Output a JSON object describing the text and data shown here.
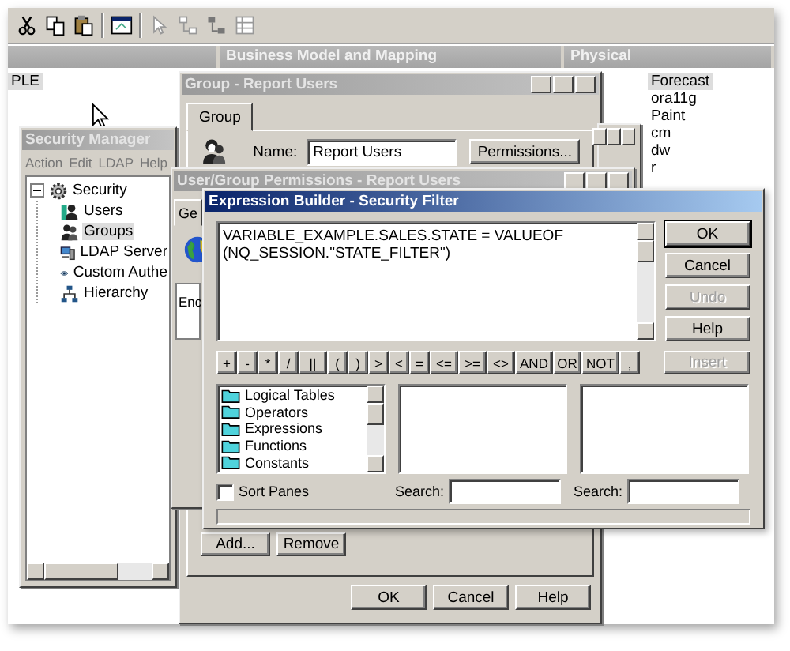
{
  "main_window": {
    "left_panel_items": [
      "PLE"
    ],
    "panel_headers": [
      "Business Model and Mapping",
      "Physical"
    ],
    "physical_items": [
      {
        "label": "Forecast",
        "selected": true
      },
      {
        "label": "ora11g",
        "selected": false
      },
      {
        "label": "Paint",
        "selected": false
      },
      {
        "label": "cm",
        "selected": false
      },
      {
        "label": "dw",
        "selected": false
      },
      {
        "label": "r",
        "selected": false
      }
    ]
  },
  "security_manager": {
    "title": "Security Manager",
    "active": false,
    "menu": [
      "Action",
      "Edit",
      "LDAP",
      "Help"
    ],
    "tree": [
      {
        "label": "Security",
        "kind": "root",
        "expanded": true,
        "selected": false,
        "children": [
          {
            "label": "Users",
            "kind": "user",
            "selected": false
          },
          {
            "label": "Groups",
            "kind": "group",
            "selected": true
          },
          {
            "label": "LDAP Server",
            "kind": "server",
            "selected": false
          },
          {
            "label": "Custom Authe",
            "kind": "eye",
            "selected": false
          },
          {
            "label": "Hierarchy",
            "kind": "hierarchy",
            "selected": false
          }
        ]
      }
    ]
  },
  "group_window": {
    "title": "Group - Report Users",
    "active": false,
    "tabs": [
      {
        "label": "Group",
        "selected": true
      }
    ],
    "name_label": "Name:",
    "name_value": "Report Users",
    "permissions_button": "Permissions...",
    "list_buttons": [
      "Add...",
      "Remove"
    ],
    "dialog_buttons": [
      "OK",
      "Cancel",
      "Help"
    ]
  },
  "permissions_window": {
    "title": "User/Group Permissions - Report Users",
    "active": false,
    "tabs": [
      {
        "label": "Ge",
        "selected": true
      }
    ],
    "list_items": [
      "Enc"
    ]
  },
  "expression_builder": {
    "title": "Expression Builder - Security Filter",
    "active": true,
    "expression": "VARIABLE_EXAMPLE.SALES.STATE = VALUEOF\n(NQ_SESSION.\"STATE_FILTER\")",
    "side_buttons": [
      {
        "label": "OK",
        "disabled": false
      },
      {
        "label": "Cancel",
        "disabled": false
      },
      {
        "label": "Undo",
        "disabled": true
      },
      {
        "label": "Help",
        "disabled": false
      }
    ],
    "operators": [
      "+",
      "-",
      "*",
      "/",
      "||",
      "(",
      ")",
      ">",
      "<",
      "=",
      "<=",
      ">=",
      "<>",
      "AND",
      "OR",
      "NOT",
      ","
    ],
    "insert_button": {
      "label": "Insert",
      "disabled": true
    },
    "categories": [
      "Logical Tables",
      "Operators",
      "Expressions",
      "Functions",
      "Constants"
    ],
    "sort_panes": {
      "label": "Sort Panes",
      "checked": false
    },
    "search_fields": [
      {
        "label": "Search:"
      },
      {
        "label": "Search:"
      }
    ]
  }
}
